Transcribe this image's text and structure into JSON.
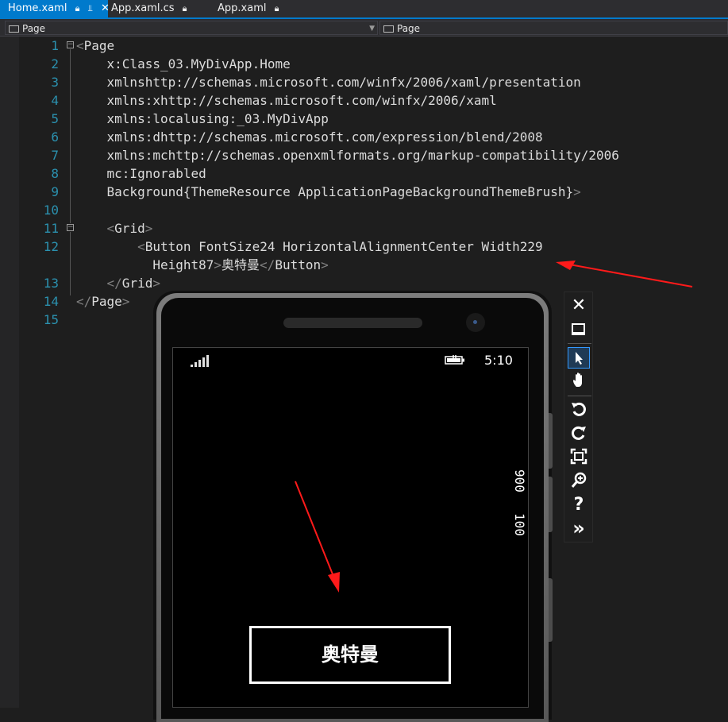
{
  "tabs": [
    {
      "label": "Home.xaml",
      "pin": "⧉",
      "pinned": "⌐",
      "close": "✕",
      "active": true
    },
    {
      "label": "App.xaml.cs",
      "pin": "⧉",
      "active": false
    },
    {
      "label": "App.xaml",
      "pin": "⧉",
      "active": false
    }
  ],
  "navbar": {
    "left": "Page",
    "right": "Page"
  },
  "lines": [
    {
      "n": "1",
      "text": "<Page"
    },
    {
      "n": "2",
      "text": "    x:Class=\"_03.MyDivApp.Home\""
    },
    {
      "n": "3",
      "text": "    xmlns=\"http://schemas.microsoft.com/winfx/2006/xaml/presentation\""
    },
    {
      "n": "4",
      "text": "    xmlns:x=\"http://schemas.microsoft.com/winfx/2006/xaml\""
    },
    {
      "n": "5",
      "text": "    xmlns:local=\"using:_03.MyDivApp\""
    },
    {
      "n": "6",
      "text": "    xmlns:d=\"http://schemas.microsoft.com/expression/blend/2008\""
    },
    {
      "n": "7",
      "text": "    xmlns:mc=\"http://schemas.openxmlformats.org/markup-compatibility/2006\""
    },
    {
      "n": "8",
      "text": "    mc:Ignorable=\"d\""
    },
    {
      "n": "9",
      "text": "    Background=\"{ThemeResource ApplicationPageBackgroundThemeBrush}\">"
    },
    {
      "n": "10",
      "text": ""
    },
    {
      "n": "11",
      "text": "    <Grid>"
    },
    {
      "n": "12",
      "text": "        <Button FontSize=\"24\" HorizontalAlignment=\"Center\" Width=\"229\""
    },
    {
      "n": "",
      "text": "          Height=\"87\">奥特曼</Button>"
    },
    {
      "n": "13",
      "text": "    </Grid>"
    },
    {
      "n": "14",
      "text": "</Page>"
    },
    {
      "n": "15",
      "text": ""
    }
  ],
  "phone": {
    "time": "5:10",
    "counter_top": "900",
    "counter_bottom": "100",
    "button_label": "奥特曼"
  },
  "emulator_tools": [
    {
      "name": "close-icon",
      "glyph": "✕",
      "selected": false
    },
    {
      "name": "minimize-icon",
      "glyph": "▁",
      "selected": false
    },
    {
      "name": "pointer-icon",
      "glyph": "↖",
      "selected": true
    },
    {
      "name": "hand-icon",
      "glyph": "✋",
      "selected": false
    },
    {
      "name": "rotate-left-icon",
      "glyph": "↺",
      "selected": false
    },
    {
      "name": "rotate-right-icon",
      "glyph": "↻",
      "selected": false
    },
    {
      "name": "fit-screen-icon",
      "glyph": "⛶",
      "selected": false
    },
    {
      "name": "zoom-icon",
      "glyph": "⊕",
      "selected": false
    },
    {
      "name": "help-icon",
      "glyph": "?",
      "selected": false
    },
    {
      "name": "expand-icon",
      "glyph": "»",
      "selected": false
    }
  ],
  "colors": {
    "accent": "#007acc",
    "line_number": "#2b91af",
    "annotation": "#ff1a1a"
  }
}
